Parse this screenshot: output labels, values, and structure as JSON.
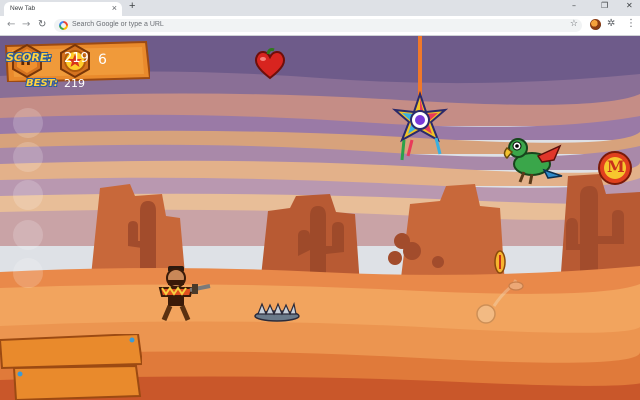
{
  "browser": {
    "tab_title": "New Tab",
    "tab_close": "×",
    "new_tab": "+",
    "omnibox_placeholder": "Search Google or type a URL",
    "window_minimize": "–",
    "window_maximize": "❐",
    "window_close": "✕",
    "back": "←",
    "forward": "→",
    "reload": "↻",
    "bookmark_star": "☆",
    "menu": "⋮",
    "extensions": "✲"
  },
  "game": {
    "pause_label": "II",
    "coin_count": "6",
    "score_label": "SCORE:",
    "score_value": "219",
    "best_label": "BEST:",
    "best_value": "219",
    "magnet_letter": "M",
    "icons": [
      "pause-icon",
      "coin-star-icon",
      "heart-icon",
      "pinata-icon",
      "parrot-icon",
      "magnet-powerup-icon",
      "bandit-character",
      "bear-trap-icon",
      "coin-icon",
      "skeleton-icon"
    ]
  },
  "colors": {
    "sky_top": "#6e5b8a",
    "sky_band_peach": "#d7a27c",
    "sky_band_purple": "#9a7aa6",
    "mesa": "#c8683a",
    "sand": "#f2a45e",
    "board_wood": "#e98a2c",
    "label_yellow": "#ffd23f"
  }
}
